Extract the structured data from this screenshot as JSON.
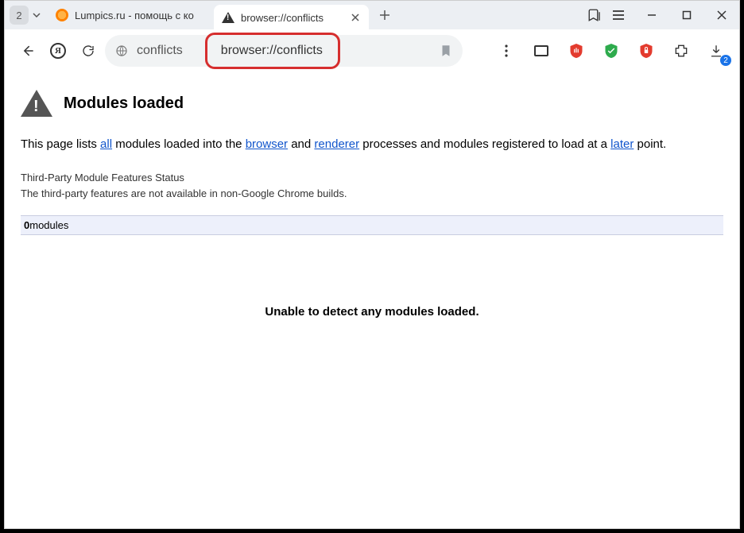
{
  "tabstrip": {
    "count": "2",
    "tabs": [
      {
        "title": "Lumpics.ru - помощь с ко"
      },
      {
        "title": "browser://conflicts"
      }
    ]
  },
  "toolbar": {
    "page_label": "conflicts",
    "url": "browser://conflicts",
    "download_count": "2"
  },
  "content": {
    "heading": "Modules loaded",
    "para_prefix": "This page lists ",
    "link_all": "all",
    "para_mid1": " modules loaded into the ",
    "link_browser": "browser",
    "para_mid2": " and ",
    "link_renderer": "renderer",
    "para_mid3": " processes and modules registered to load at a ",
    "link_later": "later",
    "para_suffix": " point.",
    "third_party_title": "Third-Party Module Features Status",
    "third_party_body": "The third-party features are not available in non-Google Chrome builds.",
    "modules_count": "0",
    "modules_label": "modules",
    "empty_msg": "Unable to detect any modules loaded."
  }
}
